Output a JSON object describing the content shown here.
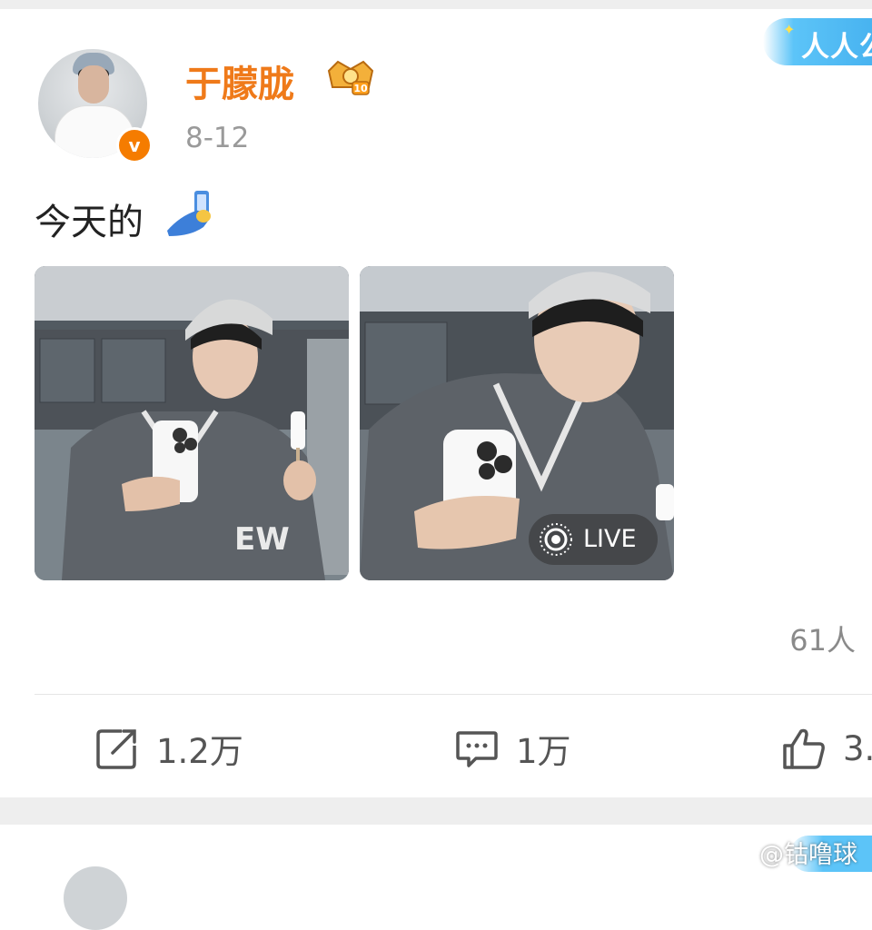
{
  "post": {
    "username": "于朦胧",
    "date": "8-12",
    "text": "今天的",
    "badge_banner": "人人公",
    "live_label": "LIVE",
    "reader_count": "61人"
  },
  "actions": {
    "repost_count": "1.2万",
    "comment_count": "1万",
    "like_count": "3."
  },
  "watermark": {
    "text": "@钴噜球"
  },
  "icons": {
    "verified": "verified-v-badge",
    "member": "crown-member-icon",
    "emoji": "selfie-emoji",
    "repost": "repost-icon",
    "comment": "comment-icon",
    "like": "thumbs-up-icon",
    "live": "live-photo-icon"
  },
  "colors": {
    "username": "#ef7a1a",
    "verified_badge": "#f57c00",
    "banner_blue": "#48b3f0"
  }
}
